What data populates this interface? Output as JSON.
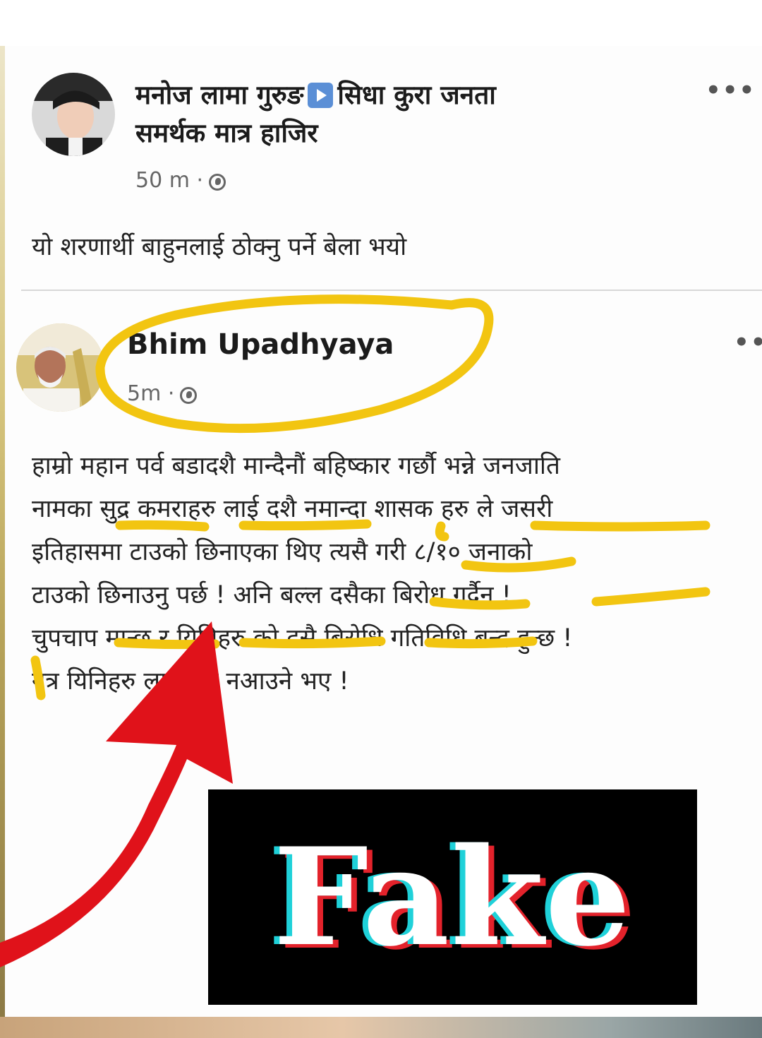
{
  "post1": {
    "author_line1": "मनोज लामा गुरुङ",
    "author_line2": "सिधा कुरा जनता",
    "author_line3": "समर्थक मात्र हाजिर",
    "time": "50 m ·",
    "more": "•••",
    "text": "यो शरणार्थी बाहुनलाई ठोक्नु पर्ने बेला भयो"
  },
  "post2": {
    "author": "Bhim Upadhyaya",
    "time": "5m ·",
    "more": "•••",
    "lines": [
      "हाम्रो महान पर्व बडादशै मान्दैनौं बहिष्कार गर्छौ भन्ने जनजाति",
      "नामका सुद्र कमराहरु लाई दशै नमान्दा शासक हरु ले जसरी",
      "इतिहासमा  टाउको छिनाएका थिए त्यसै गरी ८/१० जनाको",
      "टाउको छिनाउनु पर्छ ! अनि बल्ल दसैका बिरोध गर्दैन !",
      "चुपचाप मान्छ र यिनिहरु को दसै बिरोधि गतिविधि बन्द हुन्छ !",
      "नत्र यिनिहरु लाईजमा नआउने भए !"
    ]
  },
  "stamp": {
    "text": "Fake"
  },
  "colors": {
    "highlight": "#f2c511",
    "arrow": "#e0121a",
    "stamp_cyan": "#1fd1d9",
    "stamp_red": "#e3222b",
    "play_icon": "#5b8fd6"
  },
  "icons": [
    "play-icon",
    "globe-icon",
    "more-options-icon",
    "arrow-icon"
  ]
}
